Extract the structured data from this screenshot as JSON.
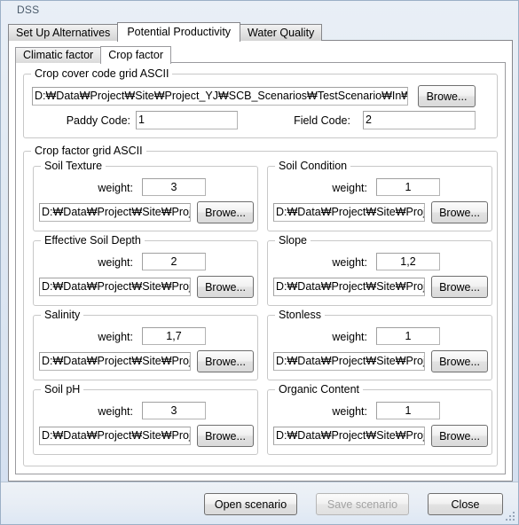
{
  "window": {
    "title": "DSS"
  },
  "outer_tabs": [
    {
      "label": "Set Up Alternatives",
      "selected": false
    },
    {
      "label": "Potential Productivity",
      "selected": true
    },
    {
      "label": "Water Quality",
      "selected": false
    }
  ],
  "inner_tabs": [
    {
      "label": "Climatic factor",
      "selected": false
    },
    {
      "label": "Crop factor",
      "selected": true
    }
  ],
  "crop_cover": {
    "title": "Crop cover code grid ASCII",
    "path_value": "D:₩Data₩Project₩Site₩Project_YJ₩SCB_Scenarios₩TestScenario₩In₩",
    "browse_label": "Browe...",
    "paddy_code_label": "Paddy Code:",
    "paddy_code_value": "1",
    "field_code_label": "Field Code:",
    "field_code_value": "2"
  },
  "crop_factor": {
    "title": "Crop factor grid ASCII",
    "weight_label": "weight:",
    "browse_label": "Browe...",
    "groups": [
      {
        "title": "Soil Texture",
        "weight": "3",
        "path": "D:₩Data₩Project₩Site₩Proje"
      },
      {
        "title": "Soil Condition",
        "weight": "1",
        "path": "D:₩Data₩Project₩Site₩Proj"
      },
      {
        "title": "Effective Soil Depth",
        "weight": "2",
        "path": "D:₩Data₩Project₩Site₩Proje"
      },
      {
        "title": "Slope",
        "weight": "1,2",
        "path": "D:₩Data₩Project₩Site₩Proj"
      },
      {
        "title": "Salinity",
        "weight": "1,7",
        "path": "D:₩Data₩Project₩Site₩Proje"
      },
      {
        "title": "Stonless",
        "weight": "1",
        "path": "D:₩Data₩Project₩Site₩Proj"
      },
      {
        "title": "Soil pH",
        "weight": "3",
        "path": "D:₩Data₩Project₩Site₩Proje"
      },
      {
        "title": "Organic Content",
        "weight": "1",
        "path": "D:₩Data₩Project₩Site₩Proj"
      }
    ]
  },
  "footer": {
    "open_label": "Open scenario",
    "save_label": "Save scenario",
    "close_label": "Close"
  }
}
